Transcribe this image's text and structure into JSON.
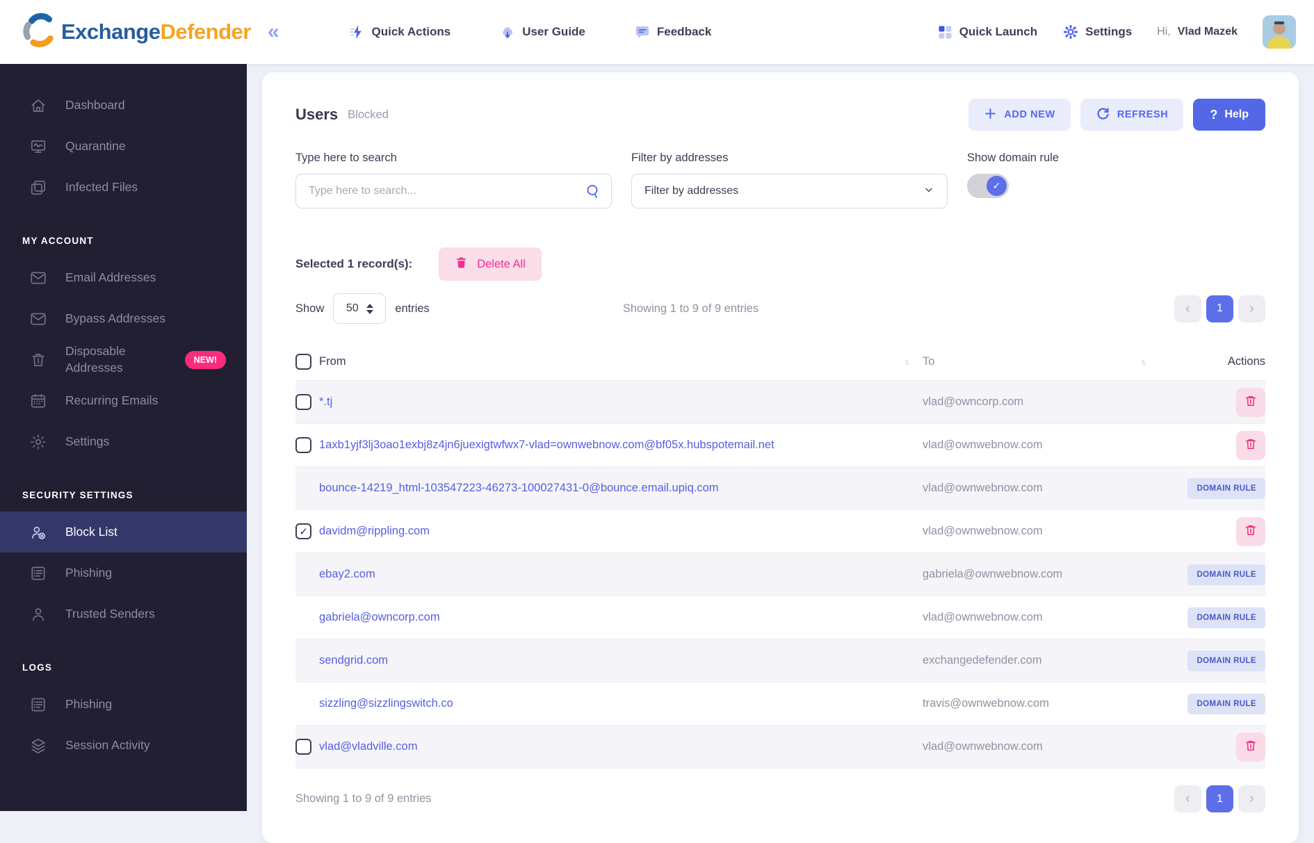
{
  "colors": {
    "accent_blue": "#5468e7",
    "brand_blue": "#265e9e",
    "brand_orange": "#f6a41f",
    "pink": "#fb2c7d",
    "delete_pink": "#f2308c",
    "sidebar_bg": "#221f33",
    "sidebar_active_bg": "#343769",
    "badge_bg": "#dde2f6",
    "badge_text": "#4559c9"
  },
  "header": {
    "brand": {
      "text_primary": "Exchange",
      "text_secondary": "Defender",
      "logo_icon": "swirl-logo"
    },
    "menu": [
      {
        "icon": "lightning",
        "label": "Quick Actions"
      },
      {
        "icon": "cloud-download",
        "label": "User Guide"
      },
      {
        "icon": "chat-bubble",
        "label": "Feedback"
      }
    ],
    "right_menu": [
      {
        "icon": "grid",
        "label": "Quick Launch"
      },
      {
        "icon": "gear-solid",
        "label": "Settings"
      }
    ],
    "user": {
      "greeting": "Hi,",
      "name": "Vlad Mazek"
    }
  },
  "sidebar": {
    "sections": [
      {
        "heading": null,
        "items": [
          {
            "icon": "home",
            "label": "Dashboard"
          },
          {
            "icon": "monitor-pulse",
            "label": "Quarantine"
          },
          {
            "icon": "copies",
            "label": "Infected Files"
          }
        ]
      },
      {
        "heading": "MY ACCOUNT",
        "items": [
          {
            "icon": "envelope",
            "label": "Email Addresses"
          },
          {
            "icon": "envelope",
            "label": "Bypass Addresses"
          },
          {
            "icon": "trash",
            "label": "Disposable Addresses",
            "badge": "NEW!"
          },
          {
            "icon": "calendar",
            "label": "Recurring Emails"
          },
          {
            "icon": "gear",
            "label": "Settings"
          }
        ]
      },
      {
        "heading": "SECURITY SETTINGS",
        "items": [
          {
            "icon": "user-block",
            "label": "Block List",
            "active": true
          },
          {
            "icon": "list",
            "label": "Phishing"
          },
          {
            "icon": "user",
            "label": "Trusted Senders"
          }
        ]
      },
      {
        "heading": "LOGS",
        "items": [
          {
            "icon": "list",
            "label": "Phishing"
          },
          {
            "icon": "layers",
            "label": "Session Activity"
          }
        ]
      }
    ]
  },
  "main": {
    "title": "Users",
    "subtitle": "Blocked",
    "buttons": {
      "add_new": "ADD NEW",
      "refresh": "REFRESH",
      "help": "Help"
    },
    "search": {
      "label": "Type here to search",
      "placeholder": "Type here to search..."
    },
    "filter": {
      "label": "Filter by addresses",
      "value": "Filter by addresses"
    },
    "toggle": {
      "label": "Show domain rule",
      "on": true
    },
    "selection": {
      "text": "Selected 1 record(s):",
      "delete_all": "Delete All"
    },
    "show_entries": {
      "prefix": "Show",
      "value": "50",
      "suffix": "entries"
    },
    "showing_text": "Showing 1 to 9 of 9 entries",
    "pagination": {
      "page": "1"
    },
    "table": {
      "columns": [
        "From",
        "To",
        "Actions"
      ],
      "domain_rule_label": "DOMAIN RULE",
      "rows": [
        {
          "from": "*.tj",
          "to": "vlad@owncorp.com",
          "checkbox": true,
          "checked": false,
          "action": "delete"
        },
        {
          "from": "1axb1yjf3lj3oao1exbj8z4jn6juexigtwfwx7-vlad=ownwebnow.com@bf05x.hubspotemail.net",
          "to": "vlad@ownwebnow.com",
          "checkbox": true,
          "checked": false,
          "action": "delete"
        },
        {
          "from": "bounce-14219_html-103547223-46273-100027431-0@bounce.email.upiq.com",
          "to": "vlad@ownwebnow.com",
          "checkbox": false,
          "checked": false,
          "action": "domain-rule"
        },
        {
          "from": "davidm@rippling.com",
          "to": "vlad@ownwebnow.com",
          "checkbox": true,
          "checked": true,
          "action": "delete"
        },
        {
          "from": "ebay2.com",
          "to": "gabriela@ownwebnow.com",
          "checkbox": false,
          "checked": false,
          "action": "domain-rule"
        },
        {
          "from": "gabriela@owncorp.com",
          "to": "vlad@ownwebnow.com",
          "checkbox": false,
          "checked": false,
          "action": "domain-rule"
        },
        {
          "from": "sendgrid.com",
          "to": "exchangedefender.com",
          "checkbox": false,
          "checked": false,
          "action": "domain-rule"
        },
        {
          "from": "sizzling@sizzlingswitch.co",
          "to": "travis@ownwebnow.com",
          "checkbox": false,
          "checked": false,
          "action": "domain-rule"
        },
        {
          "from": "vlad@vladville.com",
          "to": "vlad@ownwebnow.com",
          "checkbox": true,
          "checked": false,
          "action": "delete"
        }
      ]
    }
  }
}
